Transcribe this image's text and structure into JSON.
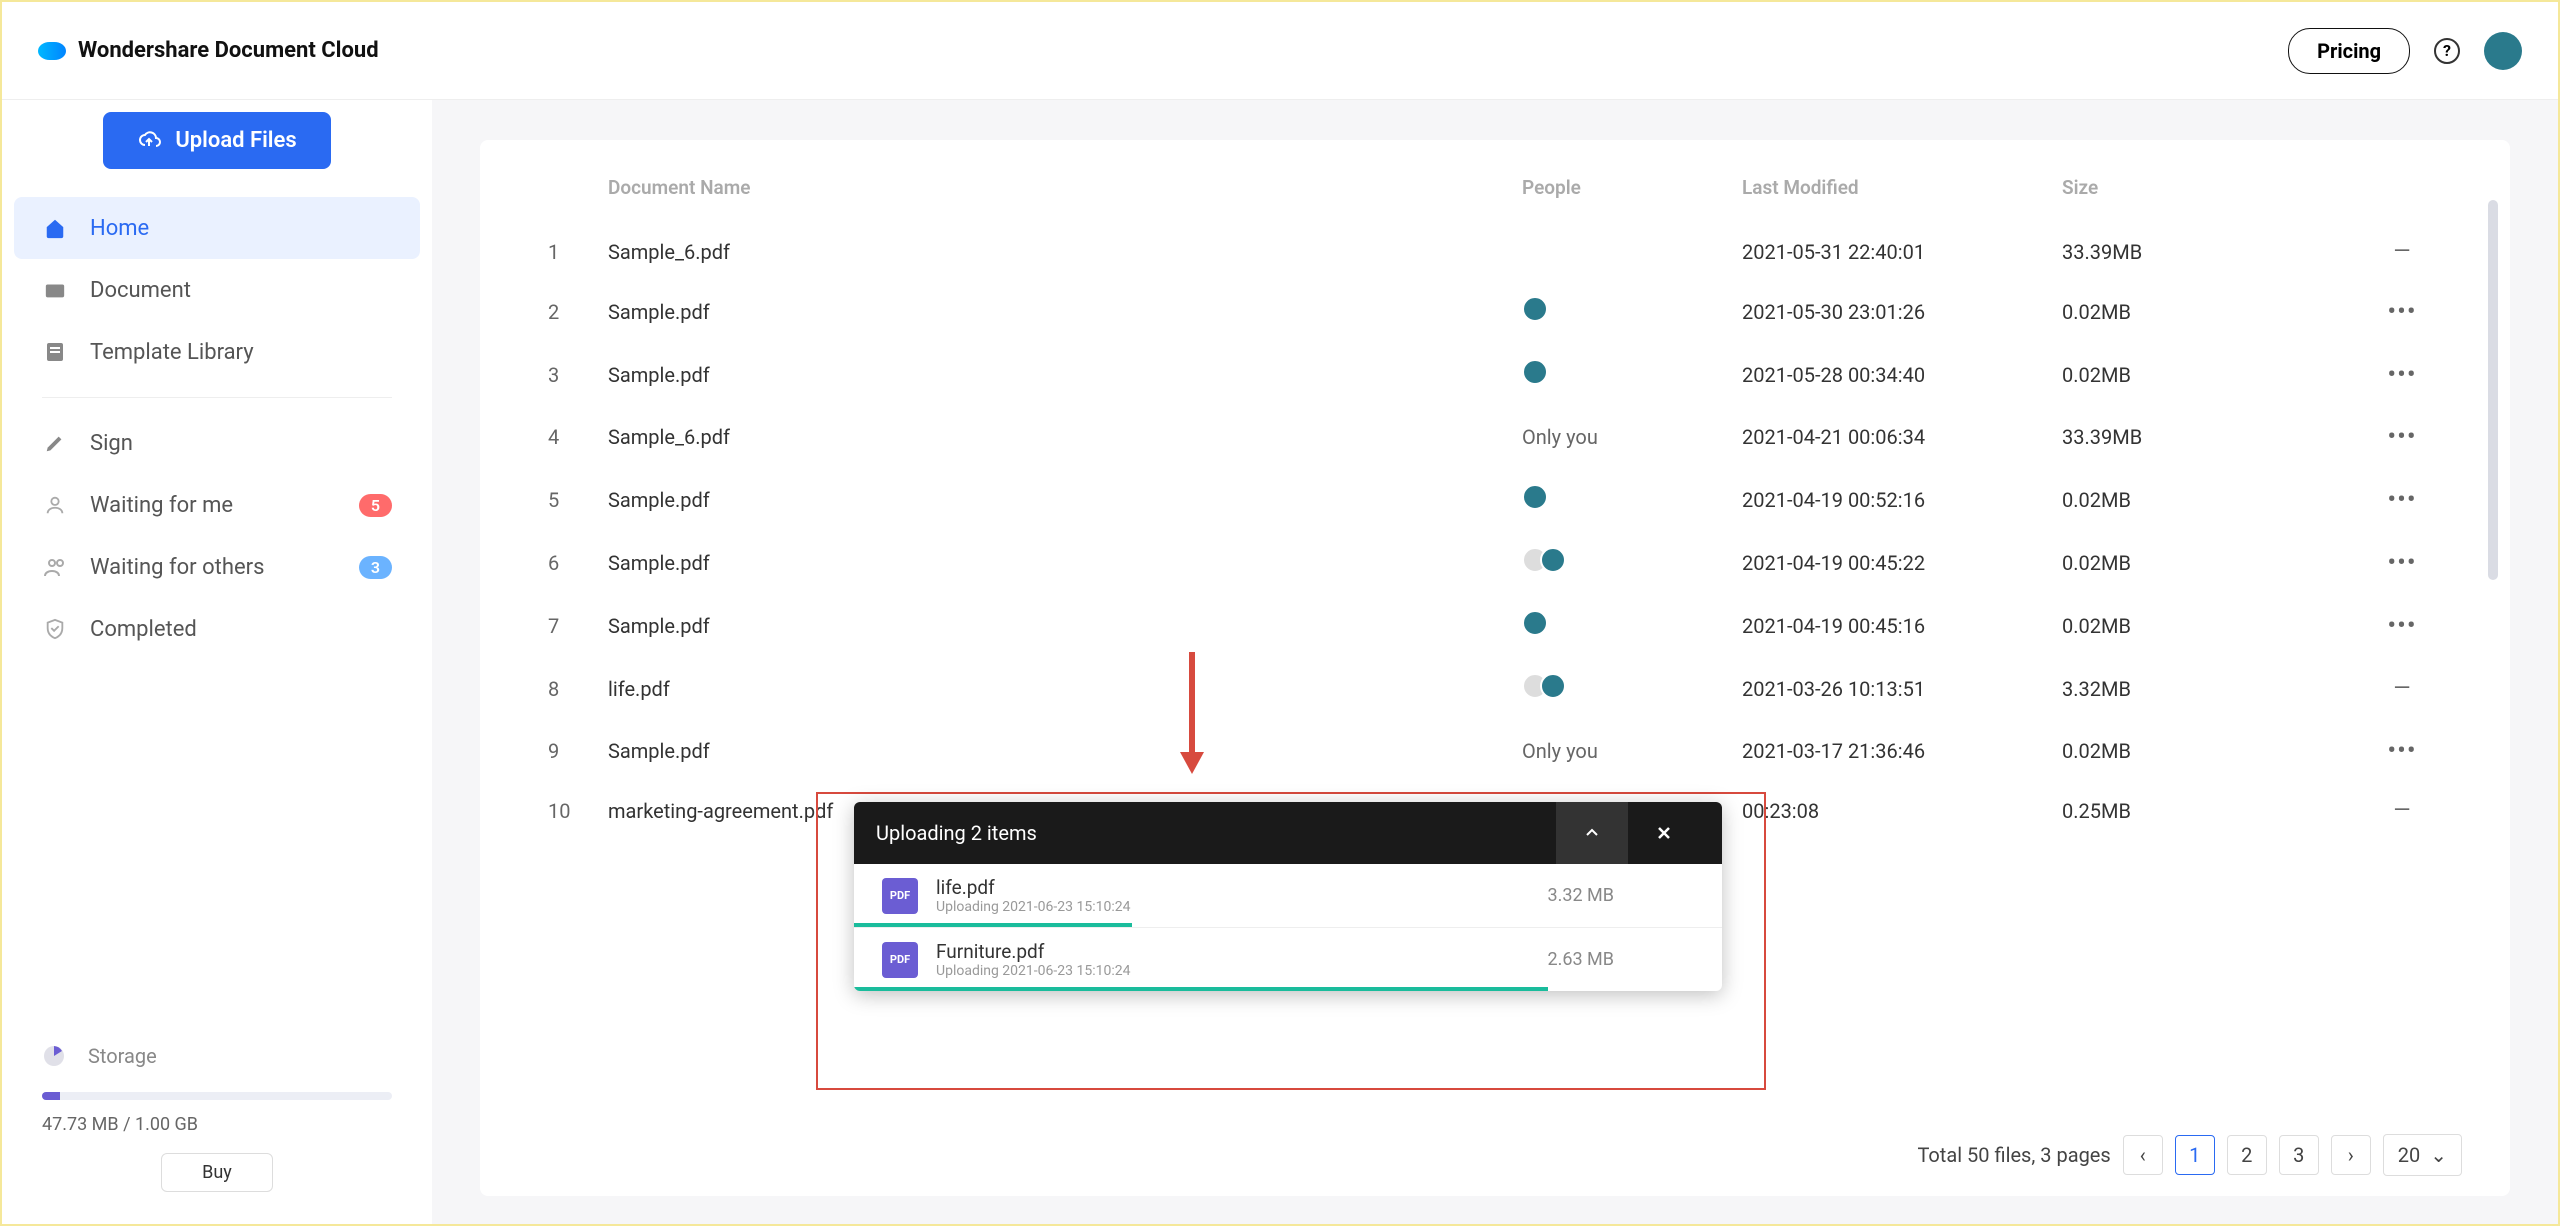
{
  "brand": "Wondershare Document Cloud",
  "topbar": {
    "pricing": "Pricing"
  },
  "upload_btn": "Upload Files",
  "nav": {
    "home": "Home",
    "document": "Document",
    "template": "Template Library",
    "sign": "Sign",
    "waiting_me": "Waiting for me",
    "waiting_me_count": "5",
    "waiting_others": "Waiting for others",
    "waiting_others_count": "3",
    "completed": "Completed"
  },
  "storage": {
    "label": "Storage",
    "text": "47.73 MB / 1.00 GB",
    "buy": "Buy"
  },
  "columns": {
    "name": "Document Name",
    "people": "People",
    "date": "Last Modified",
    "size": "Size"
  },
  "rows": [
    {
      "idx": "1",
      "name": "Sample_6.pdf",
      "people": "",
      "date": "2021-05-31 22:40:01",
      "size": "33.39MB",
      "action": "dash"
    },
    {
      "idx": "2",
      "name": "Sample.pdf",
      "people": "avatar",
      "date": "2021-05-30 23:01:26",
      "size": "0.02MB",
      "action": "dots"
    },
    {
      "idx": "3",
      "name": "Sample.pdf",
      "people": "avatar",
      "date": "2021-05-28 00:34:40",
      "size": "0.02MB",
      "action": "dots"
    },
    {
      "idx": "4",
      "name": "Sample_6.pdf",
      "people": "Only you",
      "date": "2021-04-21 00:06:34",
      "size": "33.39MB",
      "action": "dots"
    },
    {
      "idx": "5",
      "name": "Sample.pdf",
      "people": "avatar",
      "date": "2021-04-19 00:52:16",
      "size": "0.02MB",
      "action": "dots"
    },
    {
      "idx": "6",
      "name": "Sample.pdf",
      "people": "avatar2",
      "date": "2021-04-19 00:45:22",
      "size": "0.02MB",
      "action": "dots"
    },
    {
      "idx": "7",
      "name": "Sample.pdf",
      "people": "avatar",
      "date": "2021-04-19 00:45:16",
      "size": "0.02MB",
      "action": "dots"
    },
    {
      "idx": "8",
      "name": "life.pdf",
      "people": "avatar2",
      "date": "2021-03-26 10:13:51",
      "size": "3.32MB",
      "action": "dash"
    },
    {
      "idx": "9",
      "name": "Sample.pdf",
      "people": "Only you",
      "date": "2021-03-17 21:36:46",
      "size": "0.02MB",
      "action": "dots"
    },
    {
      "idx": "10",
      "name": "marketing-agreement.pdf",
      "people": "",
      "date": "00:23:08",
      "size": "0.25MB",
      "action": "dash"
    }
  ],
  "pagination": {
    "summary": "Total 50 files, 3 pages",
    "p1": "1",
    "p2": "2",
    "p3": "3",
    "per": "20"
  },
  "upload": {
    "title": "Uploading 2 items",
    "items": [
      {
        "name": "life.pdf",
        "sub": "Uploading 2021-06-23 15:10:24",
        "size": "3.32 MB",
        "pct": 32
      },
      {
        "name": "Furniture.pdf",
        "sub": "Uploading 2021-06-23 15:10:24",
        "size": "2.63 MB",
        "pct": 80
      }
    ]
  }
}
